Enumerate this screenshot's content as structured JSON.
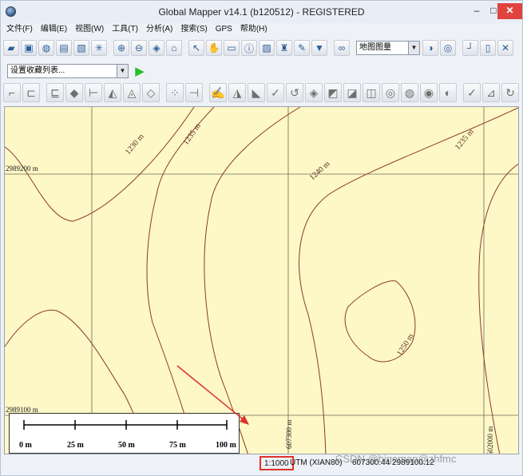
{
  "window": {
    "title": "Global Mapper v14.1 (b120512) - REGISTERED",
    "minimize": "–",
    "maximize": "□",
    "close": "✕"
  },
  "menu": [
    "文件(F)",
    "编辑(E)",
    "视图(W)",
    "工具(T)",
    "分析(A)",
    "搜索(S)",
    "GPS",
    "帮助(H)"
  ],
  "toolbar": {
    "map_style": "地图图量",
    "view_list": "设置收藏列表...",
    "icons1": [
      "open-folder-icon",
      "save-icon",
      "globe-icon",
      "layers-icon",
      "config-icon",
      "star-icon",
      "zoom-in-icon",
      "zoom-out-icon",
      "zoom-extent-icon",
      "home-icon",
      "select-icon",
      "pan-icon",
      "measure-icon",
      "info-icon",
      "image-icon",
      "tower-icon",
      "edit-icon",
      "filter-icon",
      "binoculars-icon",
      "map-icon",
      "camera-icon",
      "graph-icon",
      "doc-icon",
      "export-icon"
    ],
    "icons3": [
      "draw-icon",
      "line-icon",
      "area-icon",
      "terrain-icon",
      "contour-icon",
      "shade-icon",
      "tin-icon",
      "grid-icon",
      "point-icon",
      "feature-icon",
      "vector-icon",
      "digitize-icon",
      "cut-icon",
      "move-icon",
      "rotate-icon",
      "merge-icon",
      "split-icon",
      "vertex-icon",
      "shape-icon",
      "buffer-icon",
      "node-icon",
      "snap-icon",
      "undo-draw-icon",
      "redo-draw-icon",
      "tool-icon",
      "path-icon"
    ]
  },
  "map": {
    "grid_labels": {
      "y1": "2989200 m",
      "y2": "2989100 m",
      "x1": "607300 m",
      "x2": "602000 m"
    },
    "contour_labels": [
      "1230 m",
      "1235 m",
      "1240 m",
      "1235 m",
      "1250 m"
    ],
    "scale_bar": {
      "ticks": [
        "0 m",
        "25 m",
        "50 m",
        "75 m",
        "100 m"
      ]
    }
  },
  "status": {
    "scale": "1:1000",
    "projection": "UTM (XIAN80)",
    "coords": "607300.44  2989100.12"
  },
  "watermark": "CSDN @bigemap@zhfmc"
}
